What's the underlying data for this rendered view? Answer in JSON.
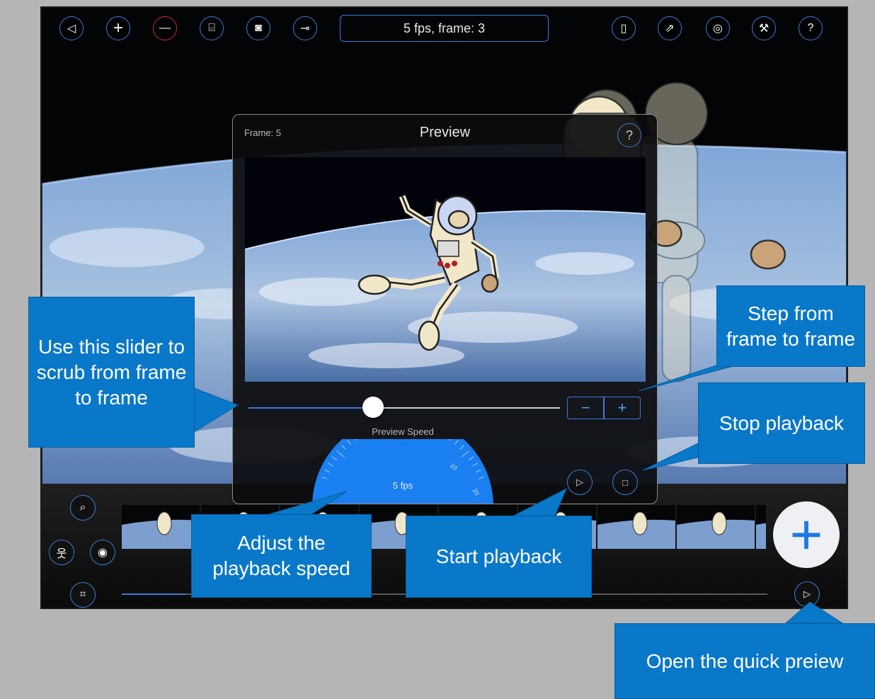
{
  "toolbar": {
    "left_buttons": [
      {
        "icon": "back-icon",
        "glyph": "◁"
      },
      {
        "icon": "plus-icon",
        "glyph": "+"
      },
      {
        "icon": "minus-icon",
        "glyph": "—"
      },
      {
        "icon": "movie-camera-icon",
        "glyph": "⌸"
      },
      {
        "icon": "camera-icon",
        "glyph": "◙"
      },
      {
        "icon": "key-icon",
        "glyph": "⊸"
      }
    ],
    "status": "5 fps, frame: 3",
    "right_buttons": [
      {
        "icon": "clipboard-icon",
        "glyph": "▯"
      },
      {
        "icon": "export-icon",
        "glyph": "⇗"
      },
      {
        "icon": "settings-icon",
        "glyph": "◎"
      },
      {
        "icon": "wrench-icon",
        "glyph": "⚒"
      },
      {
        "icon": "help-icon",
        "glyph": "?"
      }
    ]
  },
  "preview": {
    "frame_label": "Frame: 5",
    "title": "Preview",
    "help_glyph": "?",
    "slider_value": 0.4,
    "stepper_minus": "−",
    "stepper_plus": "+",
    "speed_label": "Preview Speed",
    "speed_value": "5 fps",
    "dial_ticks": [
      "10",
      "20"
    ],
    "play_glyph": "▷",
    "stop_glyph": "□"
  },
  "bottom_bar": {
    "zoom_glyph": "⌕",
    "figure_glyph": "웃",
    "onion_glyph": "◉",
    "crop_glyph": "⌗",
    "add_glyph": "+",
    "quick_play_glyph": "▷",
    "thumbnail_count": 9
  },
  "callouts": {
    "slider": "Use this slider to scrub from frame to frame",
    "step": "Step from frame to frame",
    "stop": "Stop playback",
    "speed": "Adjust the playback speed",
    "start": "Start playback",
    "quick": "Open the quick preiew"
  },
  "colors": {
    "accent": "#3d7bd8",
    "callout": "#0a78c8",
    "speed_dial": "#1a7ff0"
  }
}
